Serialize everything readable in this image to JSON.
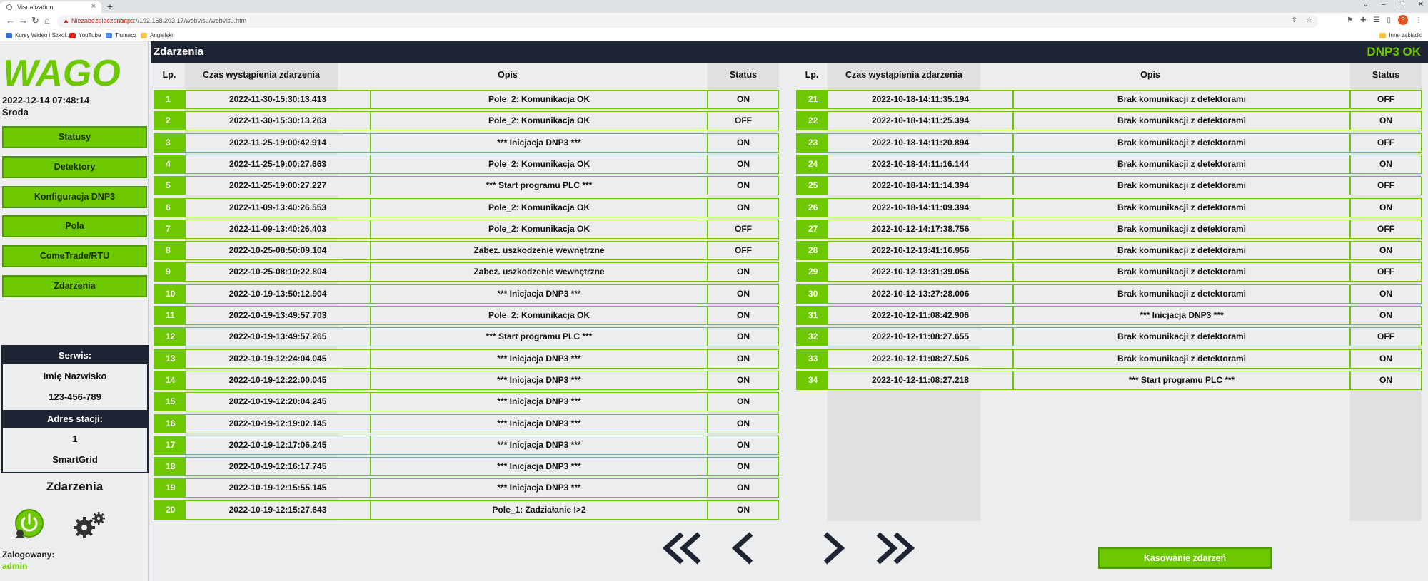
{
  "browser": {
    "tab_title": "Visualization",
    "security_label": "Niezabezpieczona",
    "url_protocol": "https",
    "url_rest": "://192.168.203.17/webvisu/webvisu.htm",
    "bookmarks": [
      {
        "label": "Kursy Wideo i Szkol...",
        "color": "#3b6fd6"
      },
      {
        "label": "YouTube",
        "color": "#e62117"
      },
      {
        "label": "Tłumacz",
        "color": "#4a86e8"
      },
      {
        "label": "Angielski",
        "color": "#f5c343"
      }
    ],
    "other_bookmarks": "Inne zakładki",
    "profile_initial": "P"
  },
  "sidebar": {
    "logo": "WAGO",
    "date": "2022-12-14 07:48:14",
    "weekday": "Środa",
    "menu": [
      "Statusy",
      "Detektory",
      "Konfiguracja DNP3",
      "Pola",
      "ComeTrade/RTU",
      "Zdarzenia"
    ],
    "service_header": "Serwis:",
    "service_name": "Imię Nazwisko",
    "service_phone": "123-456-789",
    "station_header": "Adres stacji:",
    "station_number": "1",
    "station_name": "SmartGrid",
    "current_page": "Zdarzenia",
    "logged_label": "Zalogowany:",
    "logged_user": "admin"
  },
  "header": {
    "title": "Zdarzenia",
    "status": "DNP3 OK",
    "status_color": "#6ec800"
  },
  "columns": {
    "lp": "Lp.",
    "time": "Czas wystąpienia zdarzenia",
    "desc": "Opis",
    "status": "Status"
  },
  "events_left": [
    {
      "lp": "1",
      "time": "2022-11-30-15:30:13.413",
      "desc": "Pole_2: Komunikacja OK",
      "status": "ON"
    },
    {
      "lp": "2",
      "time": "2022-11-30-15:30:13.263",
      "desc": "Pole_2: Komunikacja OK",
      "status": "OFF"
    },
    {
      "lp": "3",
      "time": "2022-11-25-19:00:42.914",
      "desc": "*** Inicjacja DNP3 ***",
      "status": "ON"
    },
    {
      "lp": "4",
      "time": "2022-11-25-19:00:27.663",
      "desc": "Pole_2: Komunikacja OK",
      "status": "ON"
    },
    {
      "lp": "5",
      "time": "2022-11-25-19:00:27.227",
      "desc": "*** Start programu PLC ***",
      "status": "ON"
    },
    {
      "lp": "6",
      "time": "2022-11-09-13:40:26.553",
      "desc": "Pole_2: Komunikacja OK",
      "status": "ON"
    },
    {
      "lp": "7",
      "time": "2022-11-09-13:40:26.403",
      "desc": "Pole_2: Komunikacja OK",
      "status": "OFF"
    },
    {
      "lp": "8",
      "time": "2022-10-25-08:50:09.104",
      "desc": "Zabez. uszkodzenie wewnętrzne",
      "status": "OFF"
    },
    {
      "lp": "9",
      "time": "2022-10-25-08:10:22.804",
      "desc": "Zabez. uszkodzenie wewnętrzne",
      "status": "ON"
    },
    {
      "lp": "10",
      "time": "2022-10-19-13:50:12.904",
      "desc": "*** Inicjacja DNP3 ***",
      "status": "ON"
    },
    {
      "lp": "11",
      "time": "2022-10-19-13:49:57.703",
      "desc": "Pole_2: Komunikacja OK",
      "status": "ON"
    },
    {
      "lp": "12",
      "time": "2022-10-19-13:49:57.265",
      "desc": "*** Start programu PLC ***",
      "status": "ON"
    },
    {
      "lp": "13",
      "time": "2022-10-19-12:24:04.045",
      "desc": "*** Inicjacja DNP3 ***",
      "status": "ON"
    },
    {
      "lp": "14",
      "time": "2022-10-19-12:22:00.045",
      "desc": "*** Inicjacja DNP3 ***",
      "status": "ON"
    },
    {
      "lp": "15",
      "time": "2022-10-19-12:20:04.245",
      "desc": "*** Inicjacja DNP3 ***",
      "status": "ON"
    },
    {
      "lp": "16",
      "time": "2022-10-19-12:19:02.145",
      "desc": "*** Inicjacja DNP3 ***",
      "status": "ON"
    },
    {
      "lp": "17",
      "time": "2022-10-19-12:17:06.245",
      "desc": "*** Inicjacja DNP3 ***",
      "status": "ON"
    },
    {
      "lp": "18",
      "time": "2022-10-19-12:16:17.745",
      "desc": "*** Inicjacja DNP3 ***",
      "status": "ON"
    },
    {
      "lp": "19",
      "time": "2022-10-19-12:15:55.145",
      "desc": "*** Inicjacja DNP3 ***",
      "status": "ON"
    },
    {
      "lp": "20",
      "time": "2022-10-19-12:15:27.643",
      "desc": "Pole_1: Zadziałanie I>2",
      "status": "ON"
    }
  ],
  "events_right": [
    {
      "lp": "21",
      "time": "2022-10-18-14:11:35.194",
      "desc": "Brak komunikacji z detektorami",
      "status": "OFF"
    },
    {
      "lp": "22",
      "time": "2022-10-18-14:11:25.394",
      "desc": "Brak komunikacji z detektorami",
      "status": "ON"
    },
    {
      "lp": "23",
      "time": "2022-10-18-14:11:20.894",
      "desc": "Brak komunikacji z detektorami",
      "status": "OFF"
    },
    {
      "lp": "24",
      "time": "2022-10-18-14:11:16.144",
      "desc": "Brak komunikacji z detektorami",
      "status": "ON"
    },
    {
      "lp": "25",
      "time": "2022-10-18-14:11:14.394",
      "desc": "Brak komunikacji z detektorami",
      "status": "OFF"
    },
    {
      "lp": "26",
      "time": "2022-10-18-14:11:09.394",
      "desc": "Brak komunikacji z detektorami",
      "status": "ON"
    },
    {
      "lp": "27",
      "time": "2022-10-12-14:17:38.756",
      "desc": "Brak komunikacji z detektorami",
      "status": "OFF"
    },
    {
      "lp": "28",
      "time": "2022-10-12-13:41:16.956",
      "desc": "Brak komunikacji z detektorami",
      "status": "ON"
    },
    {
      "lp": "29",
      "time": "2022-10-12-13:31:39.056",
      "desc": "Brak komunikacji z detektorami",
      "status": "OFF"
    },
    {
      "lp": "30",
      "time": "2022-10-12-13:27:28.006",
      "desc": "Brak komunikacji z detektorami",
      "status": "ON"
    },
    {
      "lp": "31",
      "time": "2022-10-12-11:08:42.906",
      "desc": "*** Inicjacja DNP3 ***",
      "status": "ON"
    },
    {
      "lp": "32",
      "time": "2022-10-12-11:08:27.655",
      "desc": "Brak komunikacji z detektorami",
      "status": "OFF"
    },
    {
      "lp": "33",
      "time": "2022-10-12-11:08:27.505",
      "desc": "Brak komunikacji z detektorami",
      "status": "ON"
    },
    {
      "lp": "34",
      "time": "2022-10-12-11:08:27.218",
      "desc": "*** Start programu PLC ***",
      "status": "ON"
    }
  ],
  "pager": {
    "first_icon": "double-chevron-left-icon",
    "prev_icon": "chevron-left-icon",
    "next_icon": "chevron-right-icon",
    "last_icon": "double-chevron-right-icon"
  },
  "clear_button": "Kasowanie zdarzeń",
  "accent_color": "#6ec800",
  "dark_color": "#1d2433"
}
